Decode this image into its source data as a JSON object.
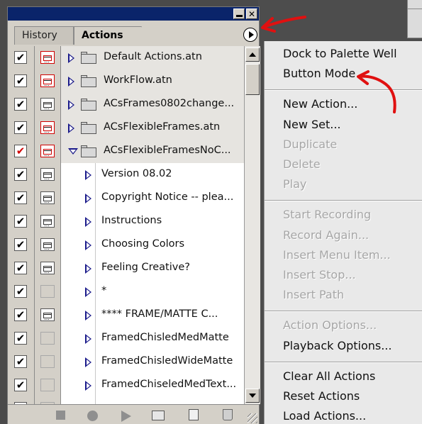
{
  "palette": {
    "tabs": [
      {
        "label": "History",
        "active": false
      },
      {
        "label": "Actions",
        "active": true
      }
    ],
    "title_buttons": {
      "minimize": "minimize-icon",
      "close": "close-icon"
    },
    "menu_button_icon": "palette-menu-arrow-icon",
    "rows": [
      {
        "type": "set",
        "label": "Default Actions.atn",
        "checked": true,
        "check_red": false,
        "dialog": "red",
        "expanded": false
      },
      {
        "type": "set",
        "label": "WorkFlow.atn",
        "checked": true,
        "check_red": false,
        "dialog": "red",
        "expanded": false
      },
      {
        "type": "set",
        "label": "ACsFrames0802change...",
        "checked": true,
        "check_red": false,
        "dialog": "black",
        "expanded": false
      },
      {
        "type": "set",
        "label": "ACsFlexibleFrames.atn",
        "checked": true,
        "check_red": false,
        "dialog": "red",
        "expanded": false
      },
      {
        "type": "set",
        "label": "ACsFlexibleFramesNoC...",
        "checked": true,
        "check_red": true,
        "dialog": "red",
        "expanded": true
      },
      {
        "type": "action",
        "label": "Version 08.02",
        "checked": true,
        "check_red": false,
        "dialog": "black"
      },
      {
        "type": "action",
        "label": "Copyright Notice -- plea...",
        "checked": true,
        "check_red": false,
        "dialog": "black"
      },
      {
        "type": "action",
        "label": "Instructions",
        "checked": true,
        "check_red": false,
        "dialog": "black"
      },
      {
        "type": "action",
        "label": "Choosing Colors",
        "checked": true,
        "check_red": false,
        "dialog": "black"
      },
      {
        "type": "action",
        "label": "Feeling Creative?",
        "checked": true,
        "check_red": false,
        "dialog": "black"
      },
      {
        "type": "action",
        "label": "*",
        "checked": true,
        "check_red": false,
        "dialog": "empty"
      },
      {
        "type": "action",
        "label": "****  FRAME/MATTE C...",
        "checked": true,
        "check_red": false,
        "dialog": "black"
      },
      {
        "type": "action",
        "label": "FramedChisledMedMatte",
        "checked": true,
        "check_red": false,
        "dialog": "empty"
      },
      {
        "type": "action",
        "label": "FramedChisledWideMatte",
        "checked": true,
        "check_red": false,
        "dialog": "empty"
      },
      {
        "type": "action",
        "label": "FramedChiseledMedText...",
        "checked": true,
        "check_red": false,
        "dialog": "empty"
      },
      {
        "type": "action",
        "label": "",
        "checked": true,
        "check_red": false,
        "dialog": "empty"
      }
    ],
    "bottom_toolbar": [
      "stop-icon",
      "record-icon",
      "play-icon",
      "new-set-folder-icon",
      "new-action-icon",
      "trash-icon"
    ]
  },
  "menu": {
    "groups": [
      [
        {
          "label": "Dock to Palette Well",
          "enabled": true
        },
        {
          "label": "Button Mode",
          "enabled": true
        }
      ],
      [
        {
          "label": "New Action...",
          "enabled": true
        },
        {
          "label": "New Set...",
          "enabled": true
        },
        {
          "label": "Duplicate",
          "enabled": false
        },
        {
          "label": "Delete",
          "enabled": false
        },
        {
          "label": "Play",
          "enabled": false
        }
      ],
      [
        {
          "label": "Start Recording",
          "enabled": false
        },
        {
          "label": "Record Again...",
          "enabled": false
        },
        {
          "label": "Insert Menu Item...",
          "enabled": false
        },
        {
          "label": "Insert Stop...",
          "enabled": false
        },
        {
          "label": "Insert Path",
          "enabled": false
        }
      ],
      [
        {
          "label": "Action Options...",
          "enabled": false
        },
        {
          "label": "Playback Options...",
          "enabled": true
        }
      ],
      [
        {
          "label": "Clear All Actions",
          "enabled": true
        },
        {
          "label": "Reset Actions",
          "enabled": true
        },
        {
          "label": "Load Actions...",
          "enabled": true
        }
      ]
    ]
  },
  "colors": {
    "title_bar": "#0a246a",
    "annotation_red": "#e01010",
    "expander_blue": "#1a1a8a",
    "dialog_red": "#d00000"
  }
}
